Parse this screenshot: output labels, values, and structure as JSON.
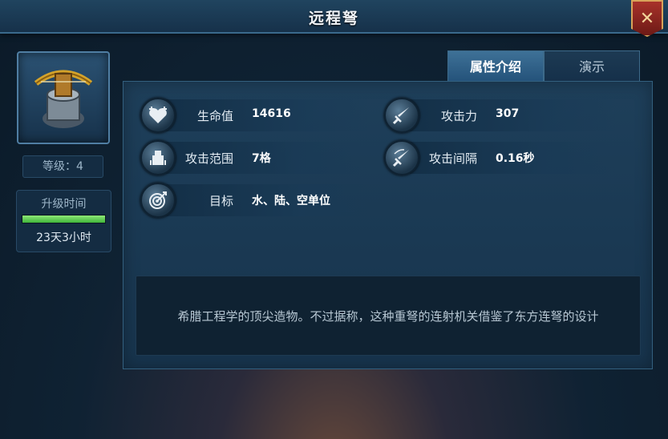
{
  "header": {
    "title": "远程弩"
  },
  "sidebar": {
    "level_label": "等级：4",
    "upgrade_label": "升级时间",
    "upgrade_time": "23天3小时",
    "upgrade_progress": 1.0
  },
  "tabs": [
    {
      "label": "属性介绍",
      "active": true
    },
    {
      "label": "演示",
      "active": false
    }
  ],
  "stats": [
    {
      "icon": "heart-plus-icon",
      "label": "生命值",
      "value": "14616"
    },
    {
      "icon": "sword-icon",
      "label": "攻击力",
      "value": "307"
    },
    {
      "icon": "range-tower-icon",
      "label": "攻击范围",
      "value": "7格"
    },
    {
      "icon": "speed-sword-icon",
      "label": "攻击间隔",
      "value": "0.16秒"
    },
    {
      "icon": "target-icon",
      "label": "目标",
      "value": "水、陆、空单位"
    }
  ],
  "description": "希腊工程学的顶尖造物。不过据称，这种重弩的连射机关借鉴了东方连弩的设计",
  "colors": {
    "accent": "#3e7197",
    "progress": "#6bd35a",
    "close": "#a8322a"
  }
}
